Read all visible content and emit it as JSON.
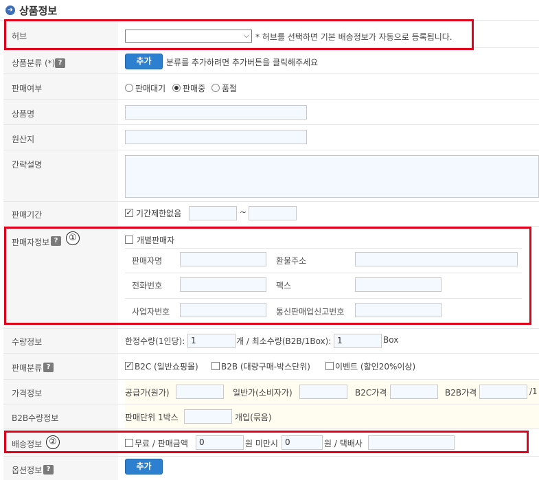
{
  "header": {
    "title": "상품정보",
    "icon": "circle-arrow-icon"
  },
  "hub": {
    "label": "허브",
    "selected": "",
    "note": "* 허브를 선택하면 기본 배송정보가 자동으로 등록됩니다."
  },
  "category": {
    "label": "상품분류 (*)",
    "add_button": "추가",
    "note": "분류를 추가하려면 추가버튼을 클릭해주세요"
  },
  "sale_status": {
    "label": "판매여부",
    "options": [
      "판매대기",
      "판매중",
      "품절"
    ],
    "selected": "판매중"
  },
  "product_name": {
    "label": "상품명",
    "value": ""
  },
  "origin": {
    "label": "원산지",
    "value": ""
  },
  "short_desc": {
    "label": "간략설명",
    "value": ""
  },
  "sale_period": {
    "label": "판매기간",
    "unlimited_label": "기간제한없음",
    "unlimited_checked": true,
    "start": "",
    "separator": "~",
    "end": ""
  },
  "seller": {
    "label": "판매자정보",
    "marker": "①",
    "individual_label": "개별판매자",
    "individual_checked": false,
    "fields": {
      "seller_name": "판매자명",
      "refund_address": "환불주소",
      "phone": "전화번호",
      "fax": "팩스",
      "business_number": "사업자번호",
      "mail_order_number": "통신판매업신고번호"
    }
  },
  "quantity": {
    "label": "수량정보",
    "limit_label": "한정수량(1인당):",
    "limit_value": "1",
    "limit_unit": "개 / 최소수량(B2B/1Box):",
    "min_value": "1",
    "min_unit": "Box"
  },
  "sale_type": {
    "label": "판매분류",
    "options": [
      {
        "label": "B2C (일반쇼핑몰)",
        "checked": true
      },
      {
        "label": "B2B (대량구매-박스단위)",
        "checked": false
      },
      {
        "label": "이벤트 (할인20%이상)",
        "checked": false
      }
    ]
  },
  "price": {
    "label": "가격정보",
    "supply": "공급가(원가)",
    "normal": "일반가(소비자가)",
    "b2c": "B2C가격",
    "b2b": "B2B가격",
    "trail": "/1"
  },
  "b2b_qty": {
    "label": "B2B수량정보",
    "unit_label": "판매단위 1박스",
    "value": "",
    "suffix": "개입(묶음)"
  },
  "shipping": {
    "label": "배송정보",
    "marker": "②",
    "free_label": "무료 / 판매금액",
    "amount": "0",
    "mid": "원 미만시",
    "fee": "0",
    "suffix": "원 / 택배사",
    "courier": ""
  },
  "options": {
    "label": "옵션정보",
    "add_button": "추가"
  },
  "colors": {
    "accent": "#2d7fd0",
    "highlight": "#e0001b",
    "label_bg": "#f6f6f6",
    "field_input_bg": "#f4f8ff"
  }
}
